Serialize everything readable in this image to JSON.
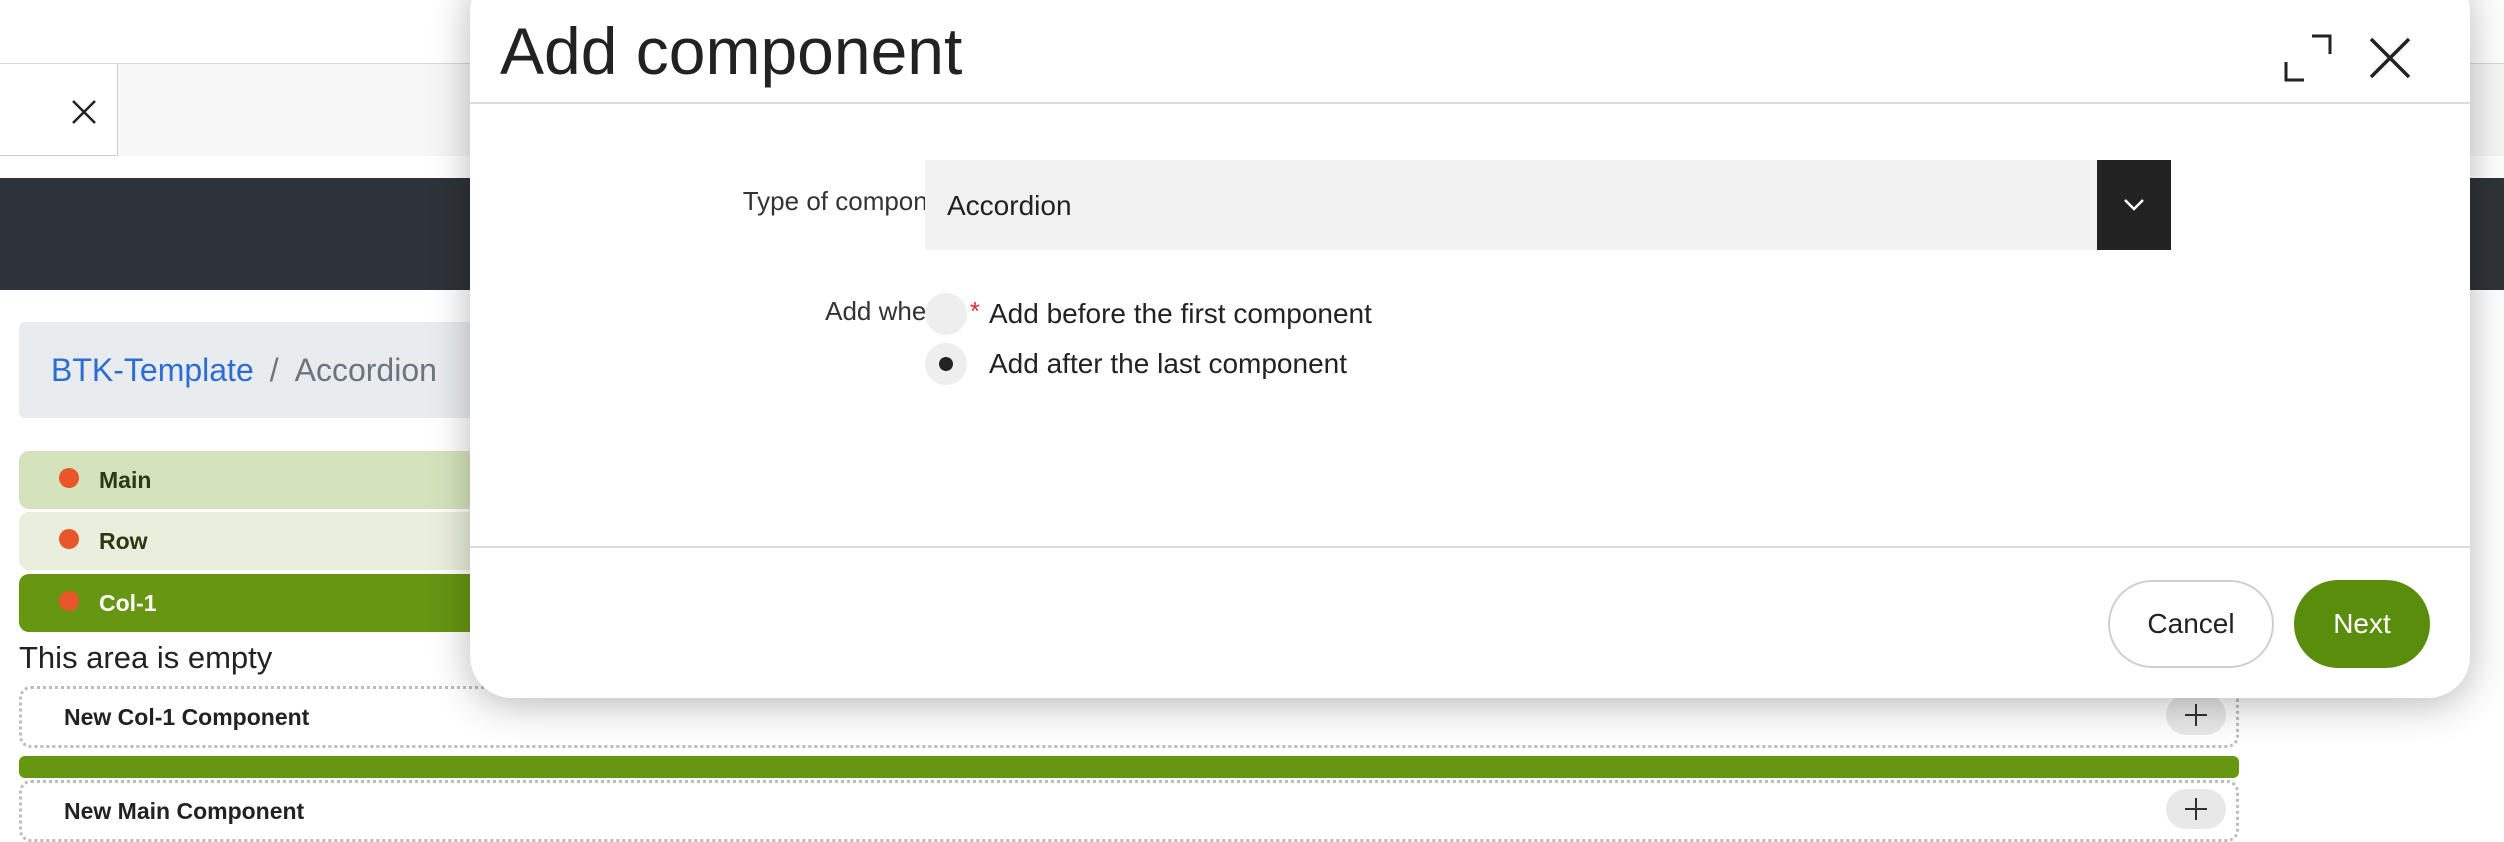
{
  "background": {
    "breadcrumb": {
      "items": [
        "BTK-Template",
        "Accordion"
      ],
      "separator": "/"
    },
    "structure": [
      {
        "label": "Main"
      },
      {
        "label": "Row"
      },
      {
        "label": "Col-1"
      }
    ],
    "empty_text": "This area is empty",
    "components": [
      {
        "label": "New Col-1 Component"
      },
      {
        "label": "New Main Component"
      }
    ]
  },
  "modal": {
    "title": "Add component",
    "fields": {
      "type": {
        "label": "Type of component",
        "required_mark": "*",
        "value": "Accordion"
      },
      "where": {
        "label": "Add where?",
        "required_mark": "*",
        "options": [
          {
            "label": "Add before the first component",
            "selected": false
          },
          {
            "label": "Add after the last component",
            "selected": true
          }
        ]
      }
    },
    "buttons": {
      "cancel": "Cancel",
      "next": "Next"
    }
  },
  "colors": {
    "accent_green": "#5b8d0c",
    "dark_bar": "#2e3339",
    "link_blue": "#2c6dd1",
    "required_red": "#d9352c",
    "status_dot": "#e8562a"
  }
}
